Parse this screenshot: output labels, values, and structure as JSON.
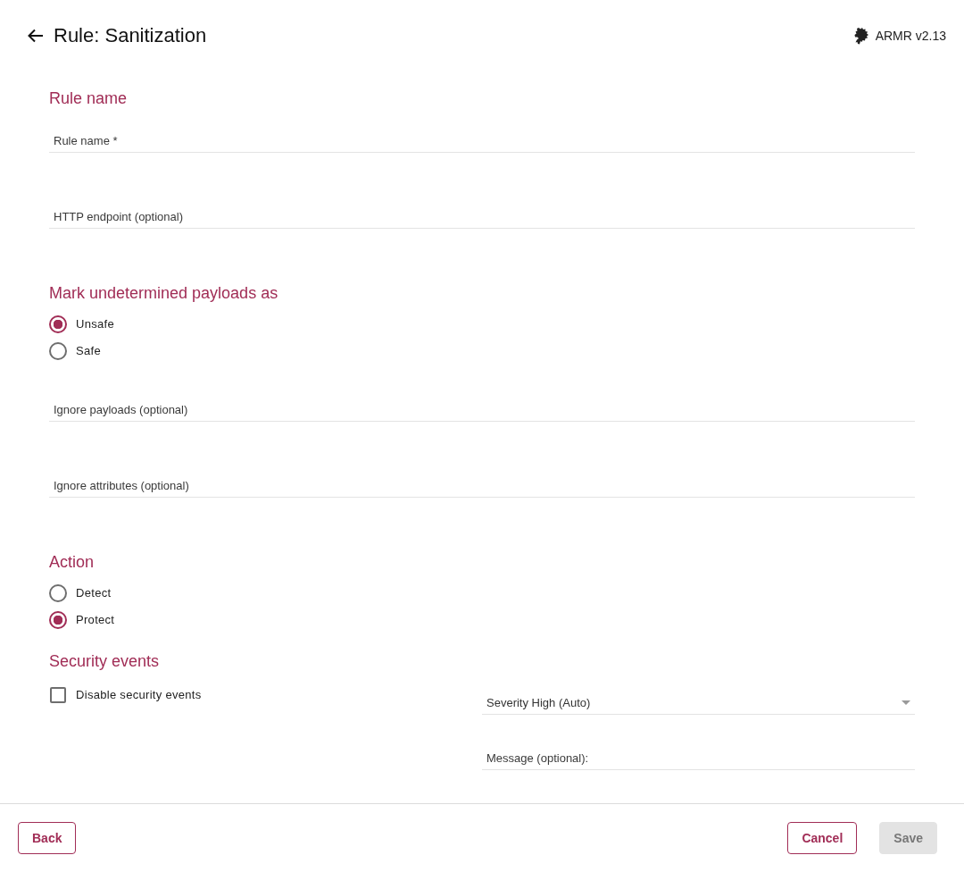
{
  "header": {
    "title": "Rule: Sanitization",
    "version": "ARMR v2.13"
  },
  "sections": [
    {
      "heading": "Rule name",
      "items": [
        {
          "kind": "field",
          "placeholder": "Rule name *"
        },
        {
          "kind": "field",
          "placeholder": "HTTP endpoint (optional)"
        }
      ]
    },
    {
      "heading": "Mark undetermined payloads as",
      "items": [
        {
          "kind": "radio",
          "label": "Unsafe",
          "selected": true
        },
        {
          "kind": "radio",
          "label": "Safe",
          "selected": false
        },
        {
          "kind": "field",
          "placeholder": "Ignore payloads (optional)"
        },
        {
          "kind": "field",
          "placeholder": "Ignore attributes (optional)"
        }
      ]
    },
    {
      "heading": "Action",
      "items": [
        {
          "kind": "radio",
          "label": "Detect",
          "selected": false
        },
        {
          "kind": "radio",
          "label": "Protect",
          "selected": true
        }
      ]
    }
  ],
  "security_events": {
    "heading": "Security events",
    "checkbox": {
      "label": "Disable security events",
      "checked": false
    },
    "severity": {
      "value": "Severity High (Auto)"
    },
    "message": {
      "placeholder": "Message (optional):"
    }
  },
  "footer": {
    "left_buttons": [
      {
        "label": "Back",
        "disabled": false
      }
    ],
    "right_buttons": [
      {
        "label": "Cancel",
        "disabled": false
      },
      {
        "label": "Save",
        "disabled": true
      }
    ]
  }
}
